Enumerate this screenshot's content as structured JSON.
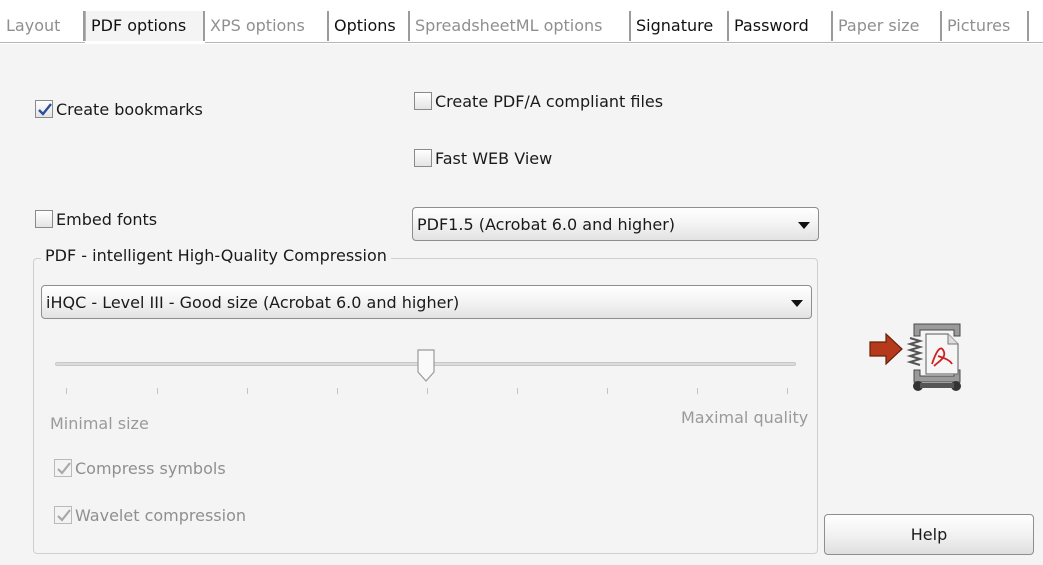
{
  "tabs": [
    {
      "label": "Layout",
      "state": "disabled"
    },
    {
      "label": "PDF options",
      "state": "selected"
    },
    {
      "label": "XPS options",
      "state": "disabled"
    },
    {
      "label": "Options",
      "state": "enabled"
    },
    {
      "label": "SpreadsheetML options",
      "state": "disabled"
    },
    {
      "label": "Signature",
      "state": "enabled"
    },
    {
      "label": "Password",
      "state": "enabled"
    },
    {
      "label": "Paper size",
      "state": "disabled"
    },
    {
      "label": "Pictures",
      "state": "disabled"
    }
  ],
  "options": {
    "create_bookmarks": {
      "label": "Create bookmarks",
      "checked": true
    },
    "create_pdfa": {
      "label": "Create PDF/A compliant files",
      "checked": false
    },
    "fast_web_view": {
      "label": "Fast WEB View",
      "checked": false
    },
    "embed_fonts": {
      "label": "Embed fonts",
      "checked": false
    }
  },
  "pdf_version": {
    "selected": "PDF1.5 (Acrobat 6.0 and higher)"
  },
  "compression": {
    "group_title": "PDF - intelligent High-Quality Compression",
    "level_selected": "iHQC - Level III - Good size (Acrobat 6.0 and higher)",
    "slider": {
      "position": 4,
      "max": 8,
      "min_label": "Minimal size",
      "max_label": "Maximal quality"
    },
    "compress_symbols": {
      "label": "Compress symbols",
      "checked": true,
      "disabled": true
    },
    "wavelet_compression": {
      "label": "Wavelet compression",
      "checked": true,
      "disabled": true
    }
  },
  "help_label": "Help",
  "colors": {
    "accent_check": "#2a4f9c",
    "logo_arrow": "#b53a1b",
    "logo_accent": "#cc2222"
  }
}
